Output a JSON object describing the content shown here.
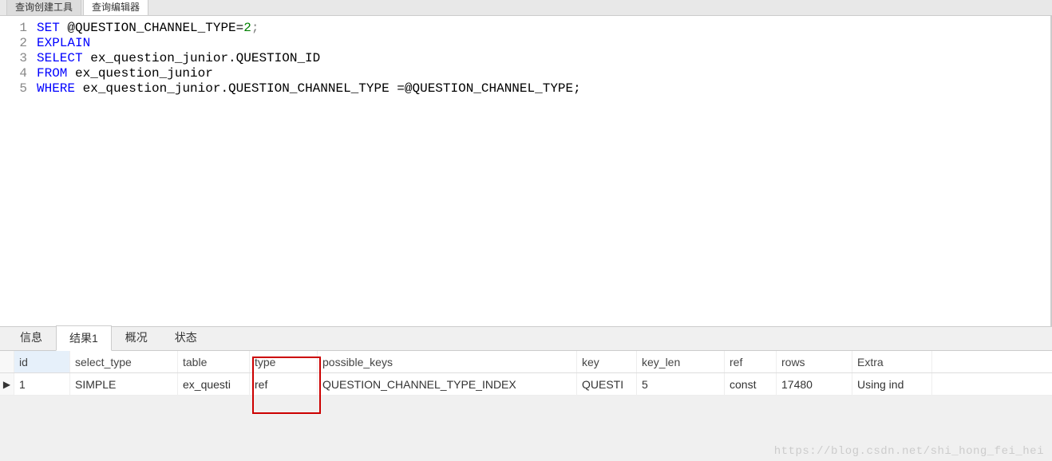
{
  "top_tabs": {
    "tab1": "查询创建工具",
    "tab2": "查询编辑器"
  },
  "code": {
    "lines": [
      {
        "num": "1",
        "tokens": [
          {
            "t": "SET",
            "c": "kw"
          },
          {
            "t": " @QUESTION_CHANNEL_TYPE=",
            "c": "ident"
          },
          {
            "t": "2",
            "c": "num"
          },
          {
            "t": ";",
            "c": "punct"
          }
        ]
      },
      {
        "num": "2",
        "tokens": [
          {
            "t": "EXPLAIN",
            "c": "kw"
          }
        ]
      },
      {
        "num": "3",
        "tokens": [
          {
            "t": "SELECT",
            "c": "kw"
          },
          {
            "t": " ex_question_junior.QUESTION_ID",
            "c": "ident"
          }
        ]
      },
      {
        "num": "4",
        "tokens": [
          {
            "t": "FROM",
            "c": "kw"
          },
          {
            "t": " ex_question_junior",
            "c": "ident"
          }
        ]
      },
      {
        "num": "5",
        "tokens": [
          {
            "t": "WHERE",
            "c": "kw"
          },
          {
            "t": " ex_question_junior.QUESTION_CHANNEL_TYPE =@QUESTION_CHANNEL_TYPE;",
            "c": "ident"
          }
        ]
      }
    ]
  },
  "bottom_tabs": {
    "info": "信息",
    "result1": "结果1",
    "profile": "概况",
    "status": "状态"
  },
  "grid": {
    "headers": {
      "id": "id",
      "select_type": "select_type",
      "table": "table",
      "type": "type",
      "possible_keys": "possible_keys",
      "key": "key",
      "key_len": "key_len",
      "ref": "ref",
      "rows": "rows",
      "extra": "Extra"
    },
    "row": {
      "indicator": "▶",
      "id": "1",
      "select_type": "SIMPLE",
      "table": "ex_questi",
      "type": "ref",
      "possible_keys": "QUESTION_CHANNEL_TYPE_INDEX",
      "key": "QUESTI",
      "key_len": "5",
      "ref": "const",
      "rows": "17480",
      "extra": "Using ind"
    }
  },
  "watermark": "https://blog.csdn.net/shi_hong_fei_hei"
}
